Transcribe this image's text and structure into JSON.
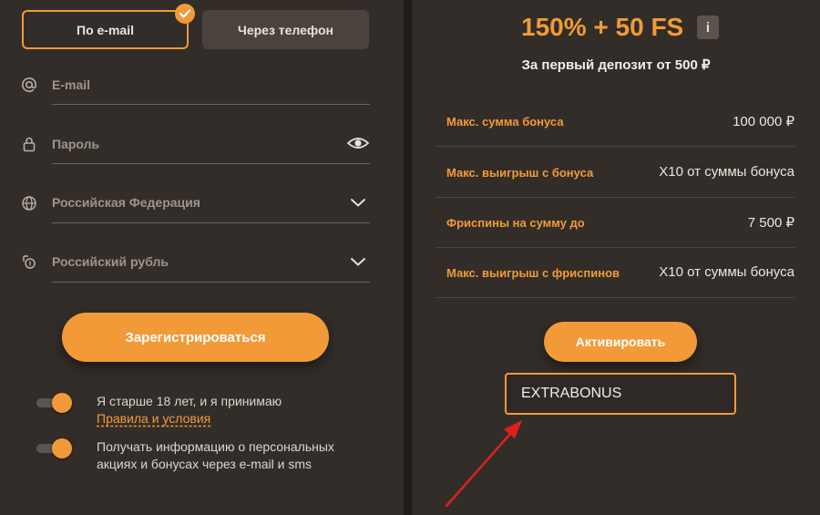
{
  "tabs": {
    "email": "По e-mail",
    "phone": "Через телефон"
  },
  "form": {
    "email_placeholder": "E-mail",
    "password_placeholder": "Пароль",
    "country": "Российская Федерация",
    "currency": "Российский рубль",
    "register_label": "Зарегистрироваться"
  },
  "consents": {
    "age_text": "Я старше 18 лет, и я принимаю",
    "rules_link": "Правила и условия",
    "promo_text_line1": "Получать информацию о персональных",
    "promo_text_line2": "акциях и бонусах через e-mail и sms"
  },
  "bonus": {
    "title": "150% + 50 FS",
    "info_icon_label": "i",
    "subtitle": "За первый депозит от 500 ₽",
    "rows": [
      {
        "label": "Макс. сумма бонуса",
        "value": "100 000 ₽"
      },
      {
        "label": "Макс. выигрыш с бонуса",
        "value": "X10 от суммы бонуса"
      },
      {
        "label": "Фриспины на сумму до",
        "value": "7 500 ₽"
      },
      {
        "label": "Макс. выигрыш с фриспинов",
        "value": "X10 от суммы бонуса"
      }
    ],
    "activate_label": "Активировать",
    "promo_code": "EXTRABONUS"
  },
  "colors": {
    "accent": "#f29a38",
    "panel": "#332d29",
    "arrow": "#e02020"
  }
}
